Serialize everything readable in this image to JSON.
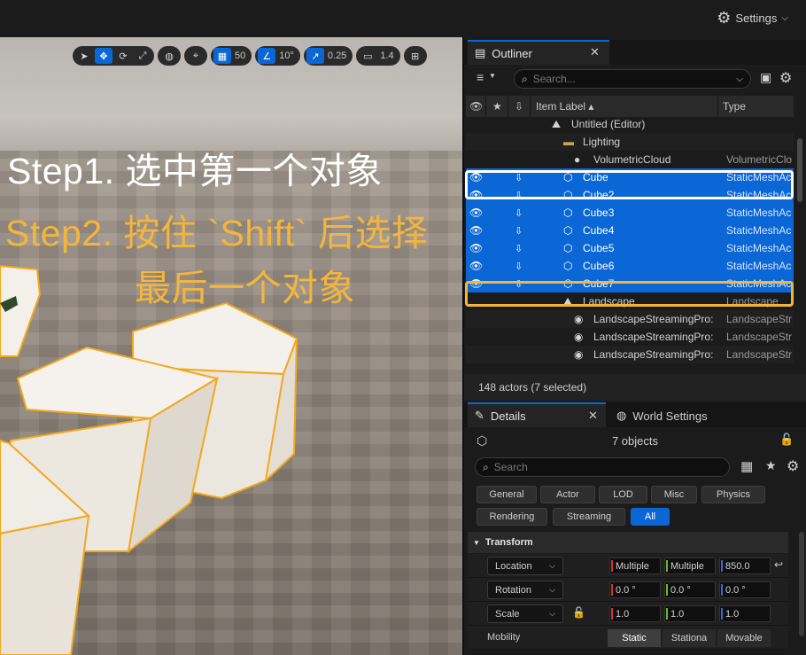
{
  "topbar": {
    "settings_label": "Settings"
  },
  "viewport": {
    "toolbar": {
      "grid_snap": "50",
      "rotate_snap": "10°",
      "scale_snap": "0.25",
      "camera_speed": "1.4"
    },
    "captions": {
      "step1": "Step1. 选中第一个对象",
      "step2": "Step2. 按住 `Shift` 后选择",
      "step2_cont": "最后一个对象"
    }
  },
  "outliner": {
    "tab_label": "Outliner",
    "search_placeholder": "Search...",
    "columns": {
      "label": "Item Label ▴",
      "type": "Type"
    },
    "rows": [
      {
        "label": "Untitled (Editor)",
        "type": "",
        "icon": "level-icon",
        "indent": 95,
        "selected": false,
        "eye": false,
        "pin": false
      },
      {
        "label": "Lighting",
        "type": "",
        "icon": "folder-icon",
        "indent": 108,
        "selected": false,
        "eye": false,
        "pin": false
      },
      {
        "label": "VolumetricCloud",
        "type": "VolumetricClo",
        "icon": "cloud-icon",
        "indent": 120,
        "selected": false,
        "eye": false,
        "pin": false
      },
      {
        "label": "Cube",
        "type": "StaticMeshAc",
        "icon": "cube-icon",
        "indent": 108,
        "selected": true,
        "eye": true,
        "pin": true
      },
      {
        "label": "Cube2",
        "type": "StaticMeshAc",
        "icon": "cube-icon",
        "indent": 108,
        "selected": true,
        "eye": true,
        "pin": true
      },
      {
        "label": "Cube3",
        "type": "StaticMeshAc",
        "icon": "cube-icon",
        "indent": 108,
        "selected": true,
        "eye": true,
        "pin": true
      },
      {
        "label": "Cube4",
        "type": "StaticMeshAc",
        "icon": "cube-icon",
        "indent": 108,
        "selected": true,
        "eye": true,
        "pin": true
      },
      {
        "label": "Cube5",
        "type": "StaticMeshAc",
        "icon": "cube-icon",
        "indent": 108,
        "selected": true,
        "eye": true,
        "pin": true
      },
      {
        "label": "Cube6",
        "type": "StaticMeshAc",
        "icon": "cube-icon",
        "indent": 108,
        "selected": true,
        "eye": true,
        "pin": true
      },
      {
        "label": "Cube7",
        "type": "StaticMeshAc",
        "icon": "cube-icon",
        "indent": 108,
        "selected": true,
        "eye": true,
        "pin": true
      },
      {
        "label": "Landscape",
        "type": "Landscape",
        "icon": "landscape-icon",
        "indent": 108,
        "selected": false,
        "eye": false,
        "pin": false
      },
      {
        "label": "LandscapeStreamingPro:",
        "type": "LandscapeStr",
        "icon": "streaming-proxy-icon",
        "indent": 120,
        "selected": false,
        "eye": false,
        "pin": false
      },
      {
        "label": "LandscapeStreamingPro:",
        "type": "LandscapeStr",
        "icon": "streaming-proxy-icon",
        "indent": 120,
        "selected": false,
        "eye": false,
        "pin": false
      },
      {
        "label": "LandscapeStreamingPro:",
        "type": "LandscapeStr",
        "icon": "streaming-proxy-icon",
        "indent": 120,
        "selected": false,
        "eye": false,
        "pin": false
      }
    ],
    "actor_count": "148 actors (7 selected)"
  },
  "details": {
    "tab_label": "Details",
    "world_settings_tab": "World Settings",
    "objects_label": "7 objects",
    "search_placeholder": "Search",
    "filters": [
      "General",
      "Actor",
      "LOD",
      "Misc",
      "Physics",
      "Rendering",
      "Streaming",
      "All"
    ],
    "active_filter": "All",
    "transform": {
      "header": "Transform",
      "location": {
        "mode": "Location",
        "x": "Multiple",
        "y": "Multiple",
        "z": "850.0"
      },
      "rotation": {
        "mode": "Rotation",
        "x": "0.0 °",
        "y": "0.0 °",
        "z": "0.0 °"
      },
      "scale": {
        "mode": "Scale",
        "x": "1.0",
        "y": "1.0",
        "z": "1.0"
      },
      "mobility": {
        "label": "Mobility",
        "options": [
          "Static",
          "Stationa",
          "Movable"
        ],
        "selected": "Static"
      }
    }
  },
  "colors": {
    "selection_blue": "#0b67d6",
    "highlight_orange": "#f4b53c",
    "highlight_white": "#ffffff"
  }
}
